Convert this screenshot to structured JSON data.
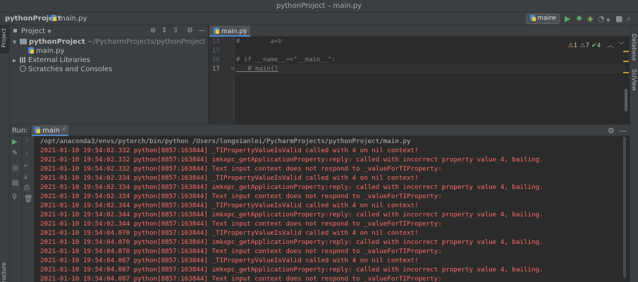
{
  "window": {
    "title": "pythonProject – main.py"
  },
  "navbar": {
    "project": "pythonProject",
    "file": "main.py",
    "run_config": "main"
  },
  "left_strip": {
    "project_tab": "Project",
    "structure_tab": "Structure"
  },
  "right_strip": {
    "database_tab": "Database",
    "sciview_tab": "SciView"
  },
  "project_panel": {
    "title": "Project",
    "tree": [
      {
        "name": "pythonProject",
        "path": "~/PycharmProjects/pythonProject"
      },
      {
        "name": "main.py"
      },
      {
        "name": "External Libraries"
      },
      {
        "name": "Scratches and Consoles"
      }
    ]
  },
  "editor": {
    "tab_label": "main.py",
    "lines": [
      {
        "num": "14",
        "text": "#        a+b"
      },
      {
        "num": "15",
        "text": ""
      },
      {
        "num": "16",
        "text": "# if __name__==\"__main__\":"
      },
      {
        "num": "17",
        "text": "   # main()"
      }
    ],
    "inspections": {
      "warnings": "1",
      "weak_warnings": "7",
      "typos": "4"
    }
  },
  "run_panel": {
    "label": "Run:",
    "tab_label": "main",
    "lines": [
      {
        "kind": "cmd",
        "text": "/opt/anaconda3/envs/pytorch/bin/python /Users/longxianlei/PycharmProjects/pythonProject/main.py"
      },
      {
        "kind": "err",
        "text": "2021-01-10 19:54:02.332 python[8857:163844] _TIPropertyValueIsValid called with 4 on nil context!"
      },
      {
        "kind": "err",
        "text": "2021-01-10 19:54:02.332 python[8857:163844] imkxpc_getApplicationProperty:reply: called with incorrect property value 4, bailing."
      },
      {
        "kind": "err",
        "text": "2021-01-10 19:54:02.332 python[8857:163844] Text input context does not respond to _valueForTIProperty:"
      },
      {
        "kind": "err",
        "text": "2021-01-10 19:54:02.334 python[8857:163844] _TIPropertyValueIsValid called with 4 on nil context!"
      },
      {
        "kind": "err",
        "text": "2021-01-10 19:54:02.334 python[8857:163844] imkxpc_getApplicationProperty:reply: called with incorrect property value 4, bailing."
      },
      {
        "kind": "err",
        "text": "2021-01-10 19:54:02.334 python[8857:163844] Text input context does not respond to _valueForTIProperty:"
      },
      {
        "kind": "err",
        "text": "2021-01-10 19:54:02.344 python[8857:163844] _TIPropertyValueIsValid called with 4 on nil context!"
      },
      {
        "kind": "err",
        "text": "2021-01-10 19:54:02.344 python[8857:163844] imkxpc_getApplicationProperty:reply: called with incorrect property value 4, bailing."
      },
      {
        "kind": "err",
        "text": "2021-01-10 19:54:02.344 python[8857:163844] Text input context does not respond to _valueForTIProperty:"
      },
      {
        "kind": "err",
        "text": "2021-01-10 19:54:04.070 python[8857:163844] _TIPropertyValueIsValid called with 4 on nil context!"
      },
      {
        "kind": "err",
        "text": "2021-01-10 19:54:04.070 python[8857:163844] imkxpc_getApplicationProperty:reply: called with incorrect property value 4, bailing."
      },
      {
        "kind": "err",
        "text": "2021-01-10 19:54:04.070 python[8857:163844] Text input context does not respond to _valueForTIProperty:"
      },
      {
        "kind": "err",
        "text": "2021-01-10 19:54:04.087 python[8857:163844] _TIPropertyValueIsValid called with 4 on nil context!"
      },
      {
        "kind": "err",
        "text": "2021-01-10 19:54:04.087 python[8857:163844] imkxpc_getApplicationProperty:reply: called with incorrect property value 4, bailing."
      },
      {
        "kind": "err",
        "text": "2021-01-10 19:54:04.087 python[8857:163844] Text input context does not respond to _valueForTIProperty:"
      }
    ]
  },
  "colors": {
    "accent": "#4a88c7",
    "error_text": "#ff6b68",
    "run_green": "#59a869",
    "warning": "#e0b84a"
  }
}
